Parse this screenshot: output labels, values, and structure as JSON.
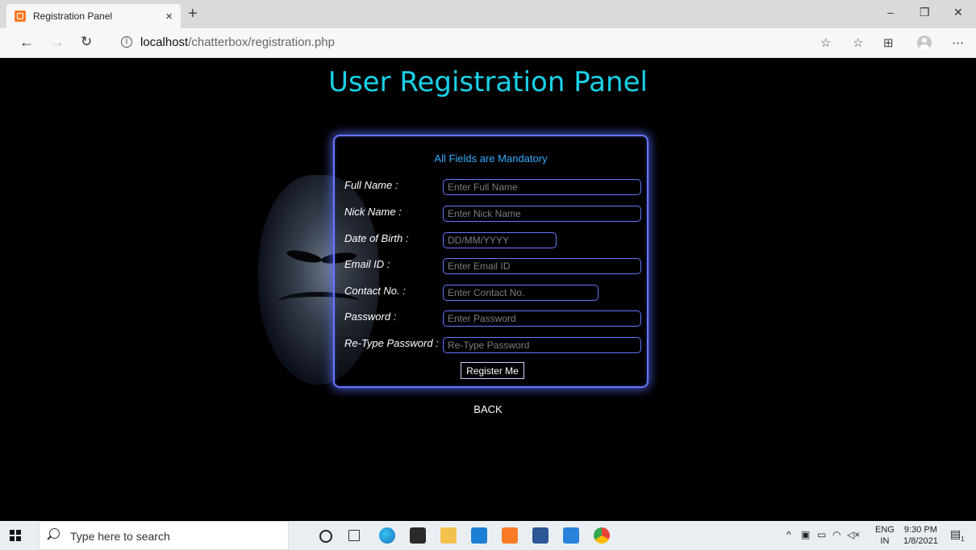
{
  "browser": {
    "tab_title": "Registration Panel",
    "tab_close": "×",
    "new_tab": "+",
    "url_host": "localhost",
    "url_path": "/chatterbox/registration.php",
    "window": {
      "minimize": "–",
      "maximize": "❐",
      "close": "✕"
    }
  },
  "page": {
    "heading": "User Registration Panel",
    "mandatory_note": "All Fields are Mandatory",
    "fields": [
      {
        "label": "Full Name :",
        "placeholder": "Enter Full Name"
      },
      {
        "label": "Nick Name :",
        "placeholder": "Enter Nick Name"
      },
      {
        "label": "Date of Birth :",
        "placeholder": "DD/MM/YYYY"
      },
      {
        "label": "Email ID :",
        "placeholder": "Enter Email ID"
      },
      {
        "label": "Contact No. :",
        "placeholder": "Enter Contact No."
      },
      {
        "label": "Password :",
        "placeholder": "Enter Password"
      },
      {
        "label": "Re-Type Password :",
        "placeholder": "Re-Type Password"
      }
    ],
    "register_button": "Register Me",
    "back_link": "BACK"
  },
  "taskbar": {
    "search_placeholder": "Type here to search",
    "language_top": "ENG",
    "language_bottom": "IN",
    "time": "9:30 PM",
    "date": "1/8/2021",
    "notification_count": "1"
  },
  "colors": {
    "heading": "#18d2e8",
    "accent_border": "#6677ff",
    "mandatory_text": "#33aaff"
  }
}
